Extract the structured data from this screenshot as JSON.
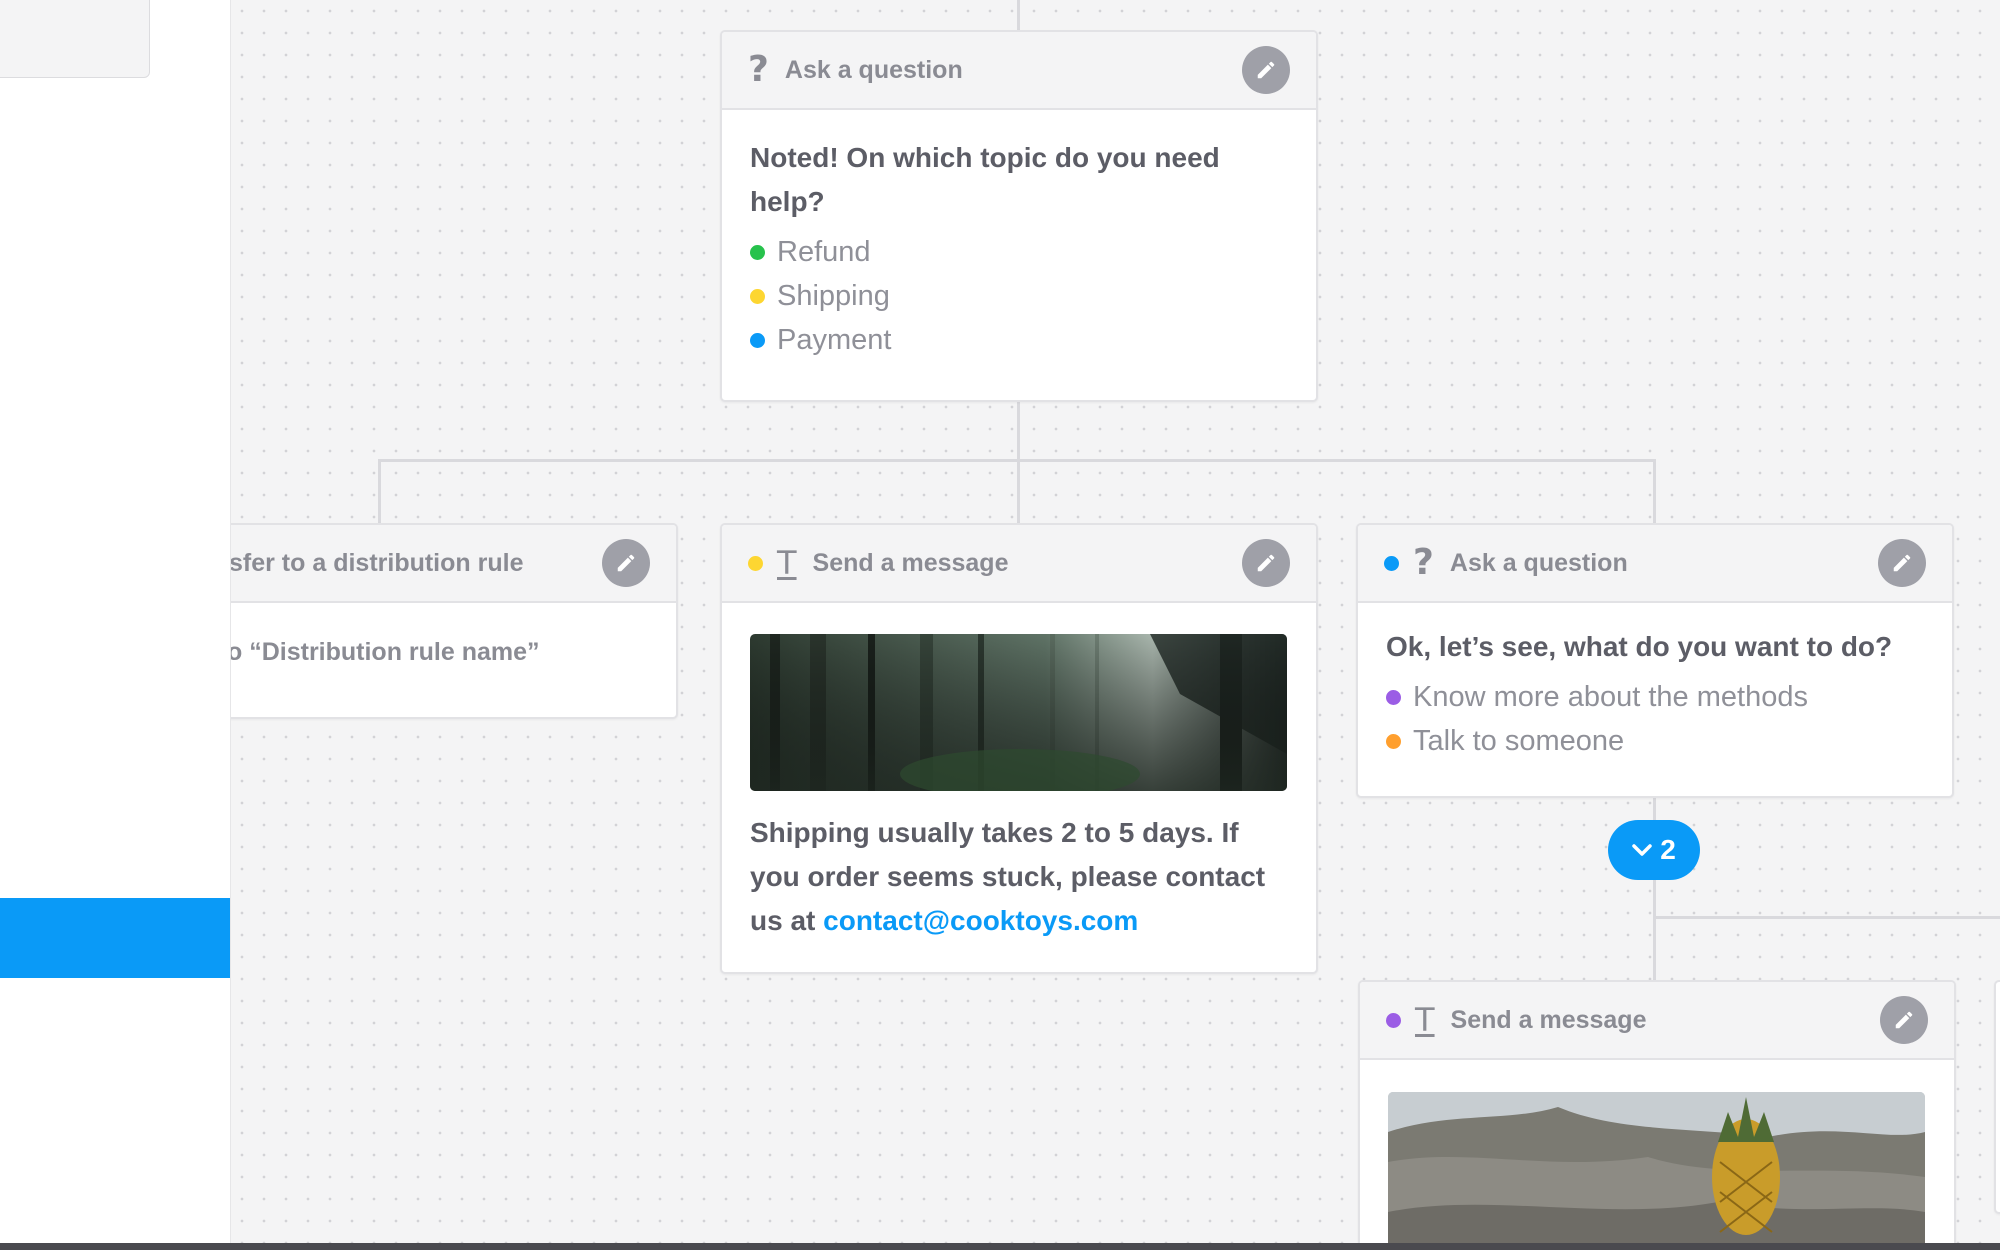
{
  "canvas": {
    "card_question_top": {
      "title": "Ask a question",
      "icon": "question-icon",
      "question": "Noted! On which topic do you need help?",
      "options": [
        {
          "label": "Refund",
          "color": "#27c24c"
        },
        {
          "label": "Shipping",
          "color": "#fdd631"
        },
        {
          "label": "Payment",
          "color": "#0a9af7"
        }
      ]
    },
    "card_transfer": {
      "title": "sfer to a distribution rule",
      "body": "o “Distribution rule name”"
    },
    "card_message_shipping": {
      "title": "Send a message",
      "icon": "text-icon",
      "dot_color": "#fdd631",
      "message_prefix": "Shipping usually takes 2 to 5 days. If you order seems stuck, please contact us at ",
      "message_link": "contact@cooktoys.com"
    },
    "card_question_payment": {
      "title": "Ask a question",
      "icon": "question-icon",
      "dot_color": "#0a9af7",
      "question": "Ok, let’s see, what do you want to do?",
      "options": [
        {
          "label": "Know more about the methods",
          "color": "#9b5de5"
        },
        {
          "label": "Talk to someone",
          "color": "#ff9f2e"
        }
      ]
    },
    "expand_button": {
      "count": "2",
      "icon": "chevron-down-icon"
    },
    "card_message_methods": {
      "title": "Send a message",
      "icon": "text-icon",
      "dot_color": "#9b5de5"
    }
  },
  "colors": {
    "accent": "#0a9af7",
    "card_header_text": "#8a8b93",
    "edit_button": "#9fa0a8"
  }
}
